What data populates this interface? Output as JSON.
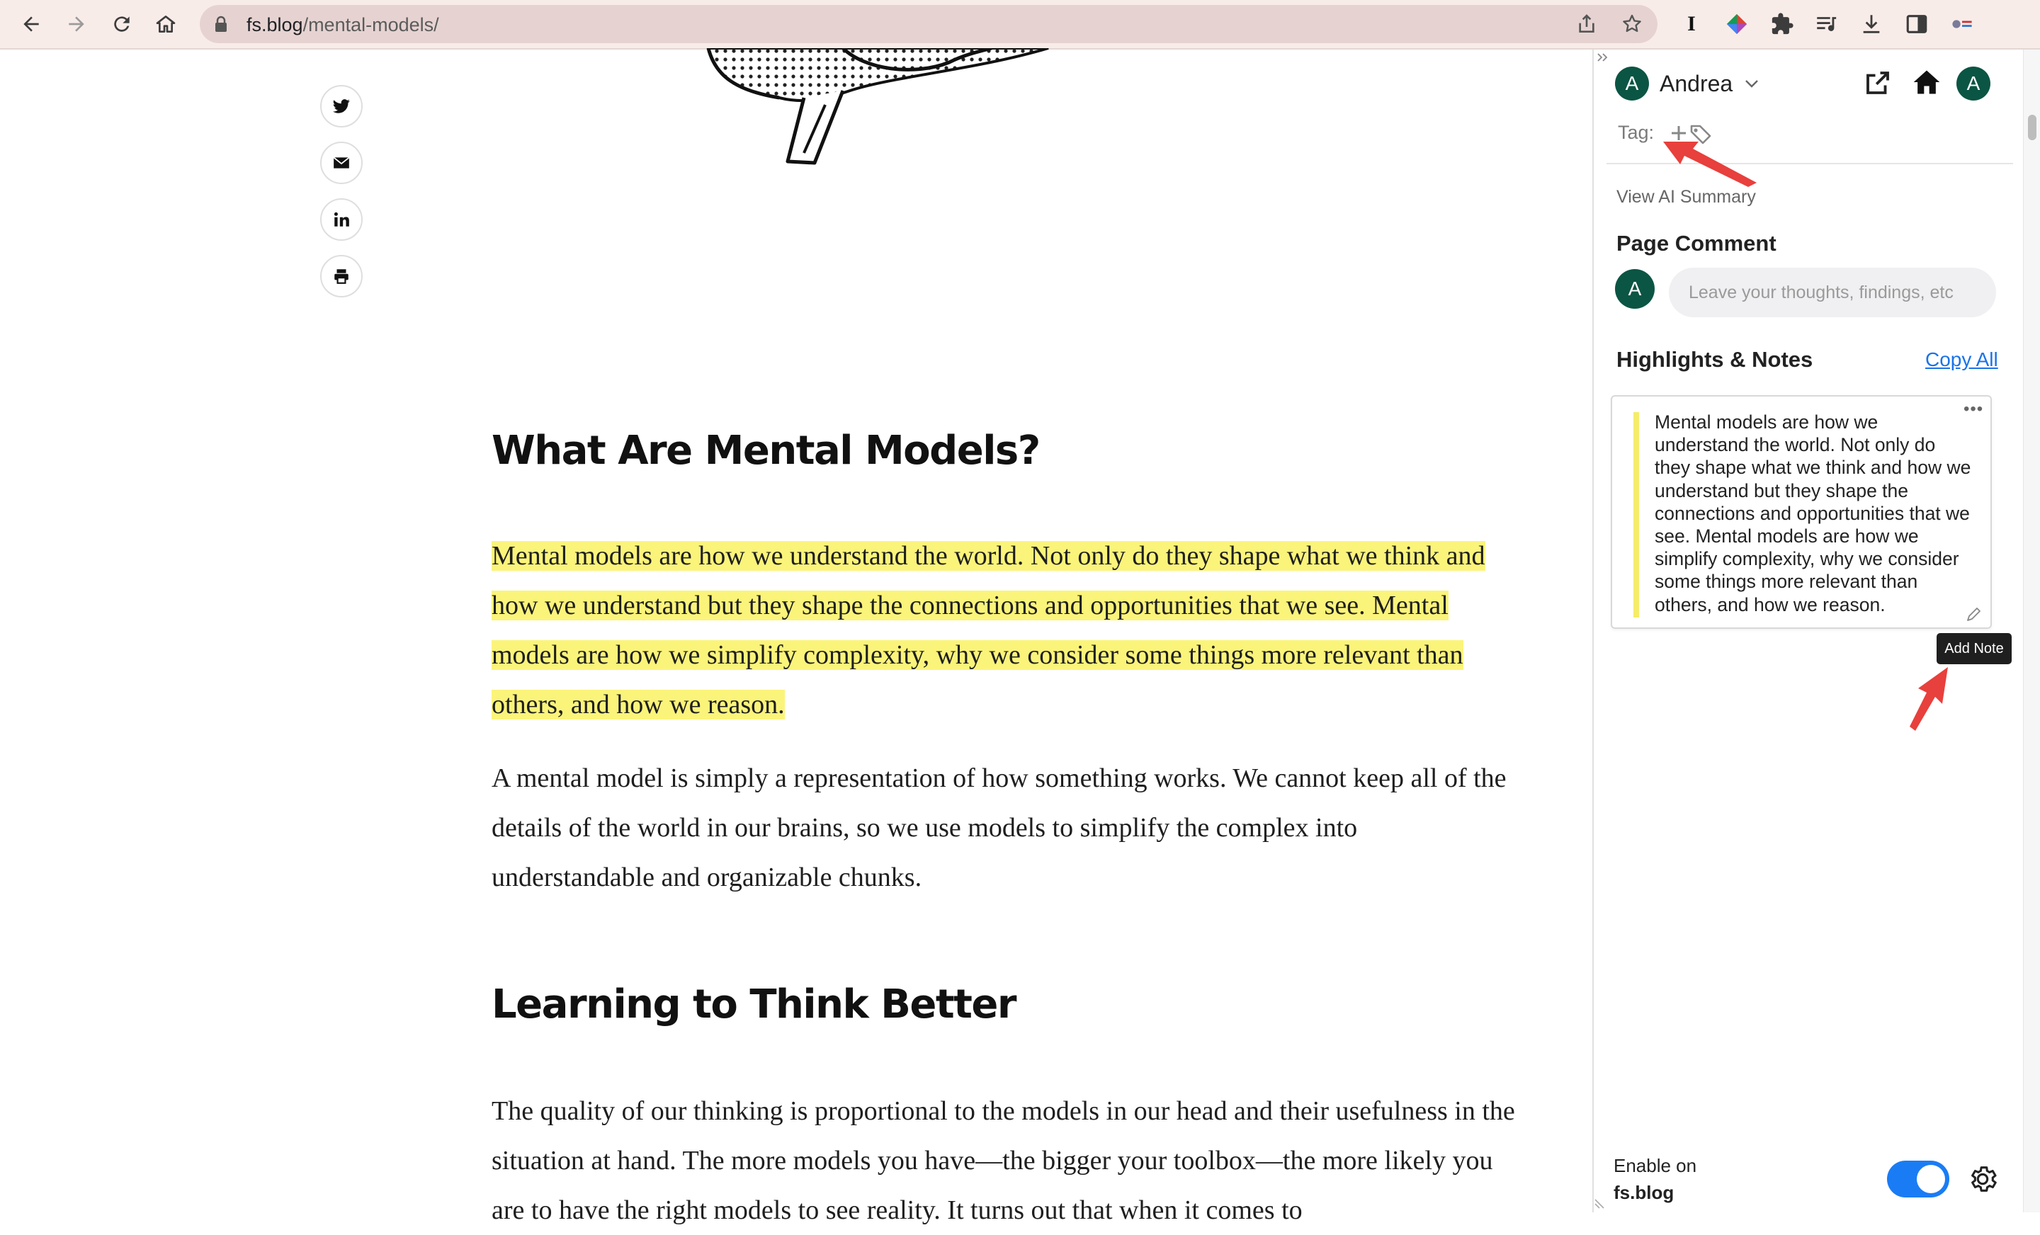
{
  "browser": {
    "url_host": "fs.blog",
    "url_path": "/mental-models/",
    "extension_i_label": "I"
  },
  "article": {
    "heading_1": "What Are Mental Models?",
    "highlighted_para": "Mental models are how we understand the world. Not only do they shape what we think and how we understand but they shape the connections and opportunities that we see. Mental models are how we simplify complexity, why we consider some things more relevant than others, and how we reason.",
    "para_2": "A mental model is simply a representation of how something works. We cannot keep all of the details of the world in our brains, so we use models to simplify the complex into understandable and organizable chunks.",
    "heading_2": "Learning to Think Better",
    "para_3": "The quality of our thinking is proportional to the models in our head and their usefulness in the situation at hand. The more models you have—the bigger your toolbox—the more likely you are to have the right models to see reality. It turns out that when it comes to"
  },
  "panel": {
    "avatar_initial": "A",
    "user_name": "Andrea",
    "tag_label": "Tag:",
    "view_ai_summary": "View AI Summary",
    "page_comment_title": "Page Comment",
    "comment_placeholder": "Leave your thoughts, findings, etc",
    "highlights_title": "Highlights & Notes",
    "copy_all": "Copy All",
    "note_text": "Mental models are how we understand the world. Not only do they shape what we think and how we understand but they shape the connections and opportunities that we see. Mental models are how we simplify complexity, why we consider some things more relevant than others, and how we reason.",
    "note_more": "•••",
    "tooltip": "Add Note",
    "enable_label": "Enable on",
    "enable_domain": "fs.blog",
    "toggle_on": true
  },
  "colors": {
    "highlight": "#fbf47a",
    "accent_blue": "#1a7cf5",
    "avatar_green": "#0b5544",
    "annotation_red": "#e8403c"
  }
}
